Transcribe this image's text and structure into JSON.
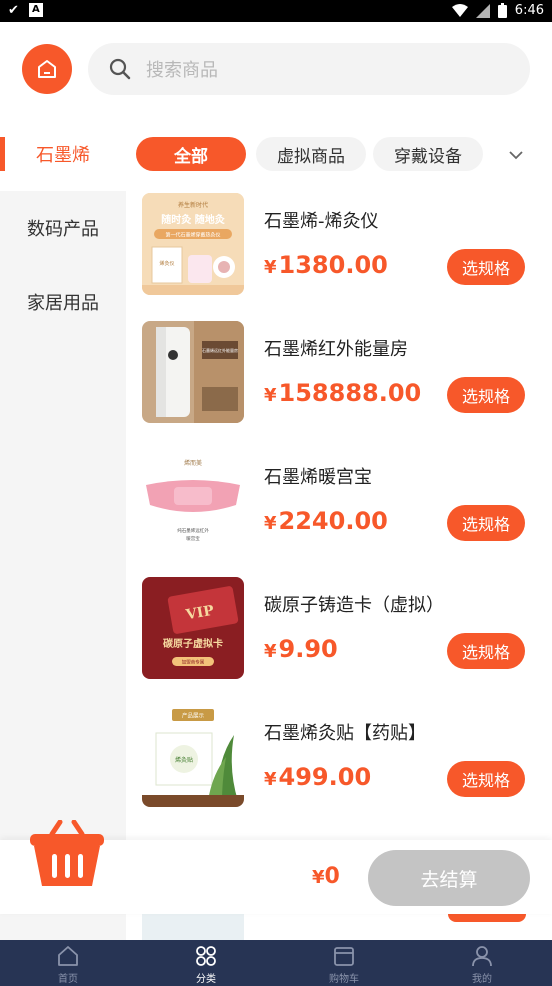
{
  "status_bar": {
    "time": "6:46",
    "left_icons": [
      "check-icon",
      "a-icon"
    ],
    "right_icons": [
      "wifi-icon",
      "signal-icon",
      "battery-icon"
    ]
  },
  "header": {
    "search_placeholder": "搜索商品"
  },
  "sidebar": {
    "items": [
      {
        "label": "石墨烯",
        "active": true
      },
      {
        "label": "数码产品",
        "active": false
      },
      {
        "label": "家居用品",
        "active": false
      }
    ]
  },
  "tabs": [
    {
      "label": "全部",
      "active": true
    },
    {
      "label": "虚拟商品",
      "active": false
    },
    {
      "label": "穿戴设备",
      "active": false
    }
  ],
  "products": [
    {
      "name": "石墨烯-烯灸仪",
      "currency": "¥",
      "price": "1380.00",
      "button": "选规格"
    },
    {
      "name": "石墨烯红外能量房",
      "currency": "¥",
      "price": "158888.00",
      "button": "选规格"
    },
    {
      "name": "石墨烯暖宫宝",
      "currency": "¥",
      "price": "2240.00",
      "button": "选规格"
    },
    {
      "name": "碳原子铸造卡（虚拟）",
      "currency": "¥",
      "price": "9.90",
      "button": "选规格"
    },
    {
      "name": "石墨烯灸贴【药贴】",
      "currency": "¥",
      "price": "499.00",
      "button": "选规格"
    }
  ],
  "thumbs": {
    "p1": {
      "tagline": "养生新时代",
      "slogan": "随时灸 随地灸",
      "sub": "第一代石墨烯穿戴热灸仪",
      "box": "烯灸仪"
    },
    "p2": {
      "label": "石墨烯远红外能量房"
    },
    "p3": {
      "brand": "烯而美",
      "tag": "纯石墨烯远红外",
      "sub": "暖宫宝"
    },
    "p4": {
      "vip": "VIP",
      "title": "碳原子虚拟卡",
      "button": "加盟商专属"
    },
    "p5": {
      "brand": "产品展示",
      "box": "烯灸贴"
    }
  },
  "cart": {
    "currency": "¥",
    "total": "0",
    "checkout_label": "去结算"
  },
  "tabbar": {
    "items": [
      {
        "label": "首页",
        "icon": "home-icon",
        "active": false
      },
      {
        "label": "分类",
        "icon": "category-icon",
        "active": true
      },
      {
        "label": "购物车",
        "icon": "cart-icon",
        "active": false
      },
      {
        "label": "我的",
        "icon": "user-icon",
        "active": false
      }
    ]
  },
  "colors": {
    "accent": "#f7582a",
    "tabbar_bg": "#273454",
    "checkout_disabled": "#c4c4c4"
  }
}
